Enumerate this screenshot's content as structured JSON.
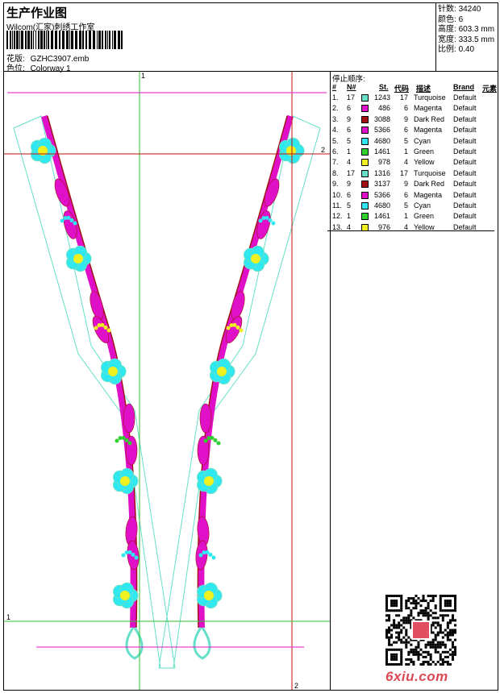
{
  "header": {
    "title": "生产作业图",
    "company": "Wilcom(汇家)刺绣工作室",
    "design_label": "花版:",
    "design_file": "GZHC3907.emb",
    "colorway_label": "色位:",
    "colorway": "Colorway 1"
  },
  "stats": [
    {
      "label": "针数:",
      "value": "34240"
    },
    {
      "label": "颜色:",
      "value": "6"
    },
    {
      "label": "高度:",
      "value": "603.3 mm"
    },
    {
      "label": "宽度:",
      "value": "333.5 mm"
    },
    {
      "label": "比例:",
      "value": "0.40"
    }
  ],
  "stop_sequence": {
    "title": "停止顺序:",
    "columns": [
      "#",
      "N#",
      "St.",
      "代码",
      "描述",
      "Brand",
      "元素"
    ],
    "rows": [
      {
        "idx": "1.",
        "n": "17",
        "color": "#66e0c8",
        "st": "1243",
        "code": "17",
        "desc": "Turquoise",
        "brand": "Default"
      },
      {
        "idx": "2.",
        "n": "6",
        "color": "#e010c8",
        "st": "486",
        "code": "6",
        "desc": "Magenta",
        "brand": "Default"
      },
      {
        "idx": "3.",
        "n": "9",
        "color": "#a01010",
        "st": "3088",
        "code": "9",
        "desc": "Dark Red",
        "brand": "Default"
      },
      {
        "idx": "4.",
        "n": "6",
        "color": "#e010c8",
        "st": "5366",
        "code": "6",
        "desc": "Magenta",
        "brand": "Default"
      },
      {
        "idx": "5.",
        "n": "5",
        "color": "#30e8f0",
        "st": "4680",
        "code": "5",
        "desc": "Cyan",
        "brand": "Default"
      },
      {
        "idx": "6.",
        "n": "1",
        "color": "#30d030",
        "st": "1461",
        "code": "1",
        "desc": "Green",
        "brand": "Default"
      },
      {
        "idx": "7.",
        "n": "4",
        "color": "#f0f020",
        "st": "978",
        "code": "4",
        "desc": "Yellow",
        "brand": "Default"
      },
      {
        "idx": "8.",
        "n": "17",
        "color": "#66e0c8",
        "st": "1316",
        "code": "17",
        "desc": "Turquoise",
        "brand": "Default"
      },
      {
        "idx": "9.",
        "n": "9",
        "color": "#a01010",
        "st": "3137",
        "code": "9",
        "desc": "Dark Red",
        "brand": "Default"
      },
      {
        "idx": "10.",
        "n": "6",
        "color": "#e010c8",
        "st": "5366",
        "code": "6",
        "desc": "Magenta",
        "brand": "Default"
      },
      {
        "idx": "11.",
        "n": "5",
        "color": "#30e8f0",
        "st": "4680",
        "code": "5",
        "desc": "Cyan",
        "brand": "Default"
      },
      {
        "idx": "12.",
        "n": "1",
        "color": "#30d030",
        "st": "1461",
        "code": "1",
        "desc": "Green",
        "brand": "Default"
      },
      {
        "idx": "13.",
        "n": "4",
        "color": "#f0f020",
        "st": "976",
        "code": "4",
        "desc": "Yellow",
        "brand": "Default"
      }
    ]
  },
  "guides": {
    "v1": "1",
    "v2": "2",
    "h1": "1",
    "h2": "2"
  },
  "watermark": "6xiu.com"
}
